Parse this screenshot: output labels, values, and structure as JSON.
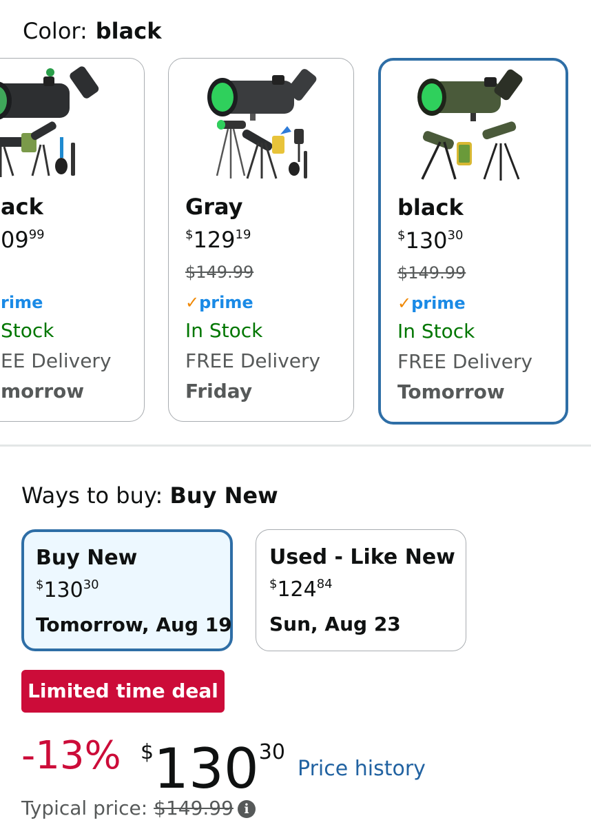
{
  "color_selector": {
    "label": "Color:",
    "selected": "black"
  },
  "swatches": [
    {
      "name": "ack",
      "price_whole": "09",
      "price_frac": "99",
      "list_price": "",
      "prime": "rime",
      "stock": "Stock",
      "delivery": "EE Delivery",
      "delivery_day": "morrow",
      "selected": false
    },
    {
      "name": "Gray",
      "price_currency": "$",
      "price_whole": "129",
      "price_frac": "19",
      "list_price": "$149.99",
      "prime": "prime",
      "stock": "In Stock",
      "delivery": "FREE Delivery",
      "delivery_day": "Friday",
      "selected": false
    },
    {
      "name": "black",
      "price_currency": "$",
      "price_whole": "130",
      "price_frac": "30",
      "list_price": "$149.99",
      "prime": "prime",
      "stock": "In Stock",
      "delivery": "FREE Delivery",
      "delivery_day": "Tomorrow",
      "selected": true
    }
  ],
  "ways_to_buy": {
    "label": "Ways to buy:",
    "selected": "Buy New"
  },
  "buy_options": [
    {
      "title": "Buy New",
      "price_currency": "$",
      "price_whole": "130",
      "price_frac": "30",
      "date": "Tomorrow, Aug 19",
      "selected": true
    },
    {
      "title": "Used - Like New",
      "price_currency": "$",
      "price_whole": "124",
      "price_frac": "84",
      "date": "Sun, Aug 23",
      "selected": false
    }
  ],
  "deal": {
    "badge": "Limited time deal",
    "discount": "-13%",
    "price_currency": "$",
    "price_whole": "130",
    "price_frac": "30",
    "price_history_link": "Price history",
    "typical_label": "Typical price:",
    "typical_price": "$149.99"
  },
  "icons": {
    "info": "info-icon",
    "prime_check": "check-icon"
  },
  "colors": {
    "selected_border": "#2e6ea6",
    "deal_red": "#cc0c39",
    "in_stock_green": "#007600",
    "prime_blue": "#1a8ae6",
    "link_blue": "#2162a1"
  }
}
